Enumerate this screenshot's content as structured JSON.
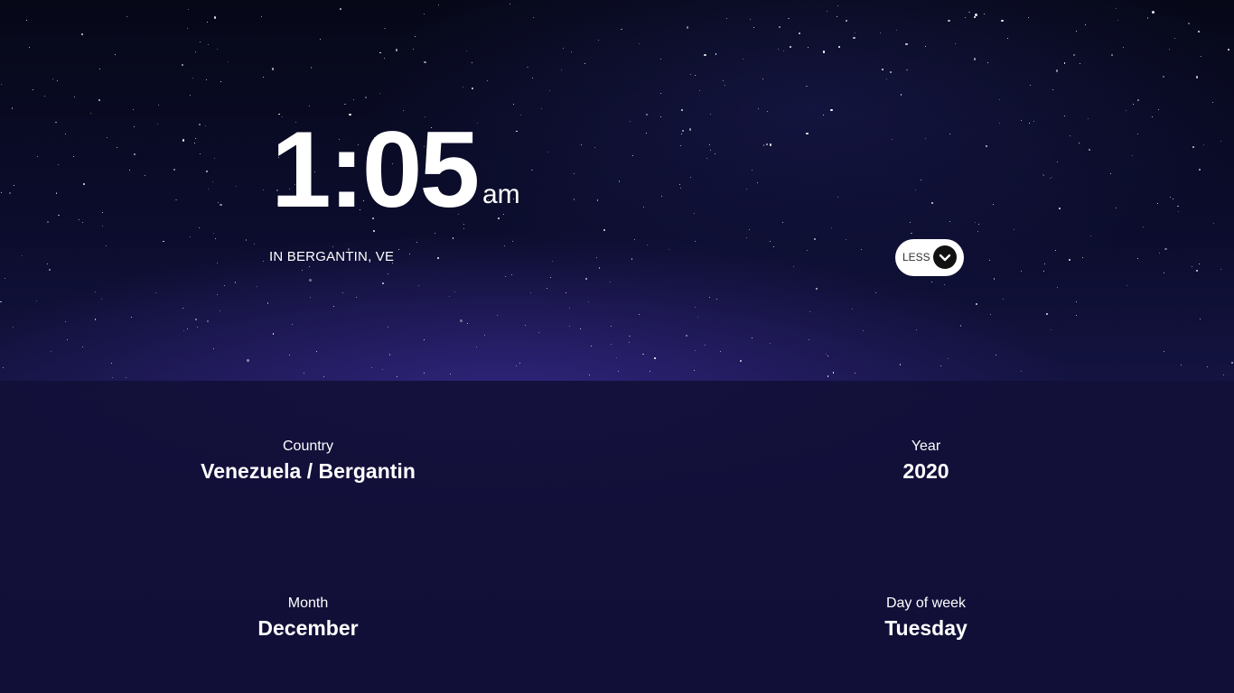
{
  "clock": {
    "time": "1:05",
    "ampm": "am",
    "location": "IN BERGANTIN, VE"
  },
  "toggle": {
    "label": "LESS",
    "icon": "chevron-down-icon"
  },
  "details": {
    "country": {
      "label": "Country",
      "value": "Venezuela / Bergantin"
    },
    "year": {
      "label": "Year",
      "value": "2020"
    },
    "month": {
      "label": "Month",
      "value": "December"
    },
    "day_of_week": {
      "label": "Day of week",
      "value": "Tuesday"
    }
  },
  "colors": {
    "background": "#07071a",
    "text": "#ffffff",
    "button_bg": "#ffffff",
    "button_icon_bg": "#111111"
  }
}
